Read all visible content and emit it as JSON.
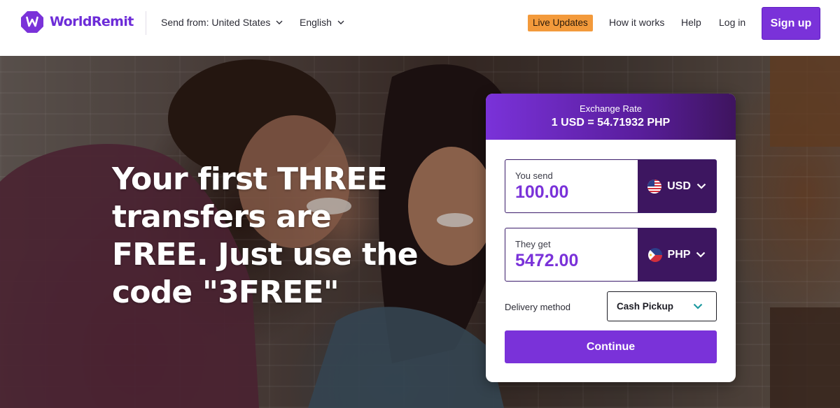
{
  "header": {
    "brand": "WorldRemit",
    "send_from_label": "Send from: United States",
    "language_label": "English",
    "live_updates_label": "Live Updates",
    "how_it_works_label": "How it works",
    "help_label": "Help",
    "login_label": "Log in",
    "signup_label": "Sign up"
  },
  "hero": {
    "headline": "Your first THREE transfers are FREE. Just use the code \"3FREE\""
  },
  "widget": {
    "exchange_rate_title": "Exchange Rate",
    "exchange_rate_value": "1 USD = 54.71932 PHP",
    "send": {
      "label": "You send",
      "amount": "100.00",
      "currency": "USD",
      "flag_icon": "us-flag-icon"
    },
    "receive": {
      "label": "They get",
      "amount": "5472.00",
      "currency": "PHP",
      "flag_icon": "ph-flag-icon"
    },
    "delivery_label": "Delivery method",
    "delivery_value": "Cash Pickup",
    "continue_label": "Continue"
  },
  "colors": {
    "brand_purple": "#7a32d9",
    "dark_purple": "#3d1660",
    "live_updates_orange": "#f39a3b",
    "teal_chevron": "#1f9aa0"
  }
}
